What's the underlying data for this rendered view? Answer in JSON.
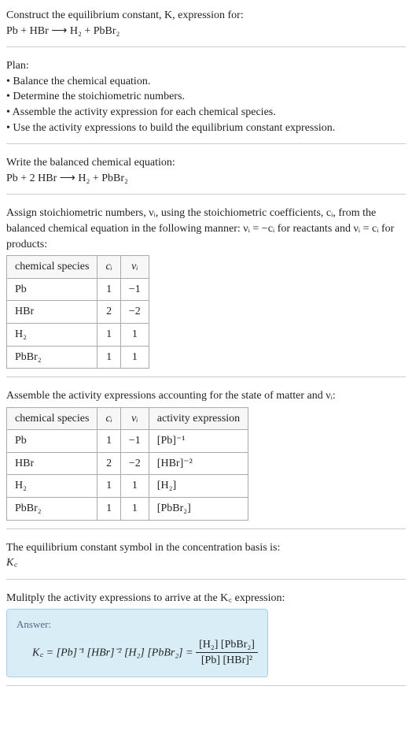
{
  "prompt": {
    "line1": "Construct the equilibrium constant, K, expression for:",
    "equation_lhs": "Pb + HBr",
    "arrow": "⟶",
    "equation_rhs": "H₂ + PbBr₂"
  },
  "plan": {
    "title": "Plan:",
    "items": [
      "Balance the chemical equation.",
      "Determine the stoichiometric numbers.",
      "Assemble the activity expression for each chemical species.",
      "Use the activity expressions to build the equilibrium constant expression."
    ]
  },
  "balanced": {
    "title": "Write the balanced chemical equation:",
    "lhs": "Pb + 2 HBr",
    "arrow": "⟶",
    "rhs": "H₂ + PbBr₂"
  },
  "stoich": {
    "intro_part1": "Assign stoichiometric numbers, νᵢ, using the stoichiometric coefficients, cᵢ, from the balanced chemical equation in the following manner: νᵢ = −cᵢ for reactants and νᵢ = cᵢ for products:",
    "headers": {
      "species": "chemical species",
      "c": "cᵢ",
      "v": "νᵢ"
    },
    "rows": [
      {
        "species": "Pb",
        "c": "1",
        "v": "−1"
      },
      {
        "species": "HBr",
        "c": "2",
        "v": "−2"
      },
      {
        "species": "H₂",
        "c": "1",
        "v": "1"
      },
      {
        "species": "PbBr₂",
        "c": "1",
        "v": "1"
      }
    ]
  },
  "activity": {
    "intro": "Assemble the activity expressions accounting for the state of matter and νᵢ:",
    "headers": {
      "species": "chemical species",
      "c": "cᵢ",
      "v": "νᵢ",
      "expr": "activity expression"
    },
    "rows": [
      {
        "species": "Pb",
        "c": "1",
        "v": "−1",
        "expr": "[Pb]⁻¹"
      },
      {
        "species": "HBr",
        "c": "2",
        "v": "−2",
        "expr": "[HBr]⁻²"
      },
      {
        "species": "H₂",
        "c": "1",
        "v": "1",
        "expr": "[H₂]"
      },
      {
        "species": "PbBr₂",
        "c": "1",
        "v": "1",
        "expr": "[PbBr₂]"
      }
    ]
  },
  "symbol": {
    "title": "The equilibrium constant symbol in the concentration basis is:",
    "sym": "K꜀"
  },
  "final": {
    "title": "Mulitply the activity expressions to arrive at the K꜀ expression:",
    "answer_label": "Answer:",
    "lhs": "K꜀ = [Pb]⁻¹ [HBr]⁻² [H₂] [PbBr₂] =",
    "frac_num": "[H₂] [PbBr₂]",
    "frac_den": "[Pb] [HBr]²"
  },
  "chart_data": {
    "type": "table",
    "tables": [
      {
        "title": "stoichiometric numbers",
        "columns": [
          "chemical species",
          "cᵢ",
          "νᵢ"
        ],
        "rows": [
          [
            "Pb",
            1,
            -1
          ],
          [
            "HBr",
            2,
            -2
          ],
          [
            "H₂",
            1,
            1
          ],
          [
            "PbBr₂",
            1,
            1
          ]
        ]
      },
      {
        "title": "activity expressions",
        "columns": [
          "chemical species",
          "cᵢ",
          "νᵢ",
          "activity expression"
        ],
        "rows": [
          [
            "Pb",
            1,
            -1,
            "[Pb]⁻¹"
          ],
          [
            "HBr",
            2,
            -2,
            "[HBr]⁻²"
          ],
          [
            "H₂",
            1,
            1,
            "[H₂]"
          ],
          [
            "PbBr₂",
            1,
            1,
            "[PbBr₂]"
          ]
        ]
      }
    ]
  }
}
